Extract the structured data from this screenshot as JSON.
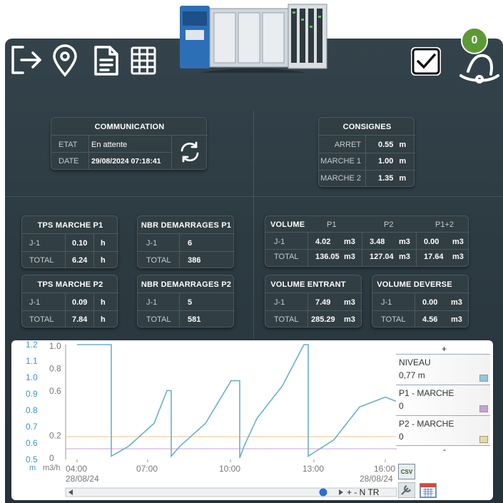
{
  "badge": {
    "count": "0"
  },
  "communication": {
    "title": "COMMUNICATION",
    "etat_label": "ETAT",
    "etat_value": "En attente",
    "date_label": "DATE",
    "date_value": "29/08/2024 07:18:41"
  },
  "consignes": {
    "title": "CONSIGNES",
    "rows": [
      {
        "label": "ARRET",
        "value": "0.55",
        "unit": "m"
      },
      {
        "label": "MARCHE 1",
        "value": "1.00",
        "unit": "m"
      },
      {
        "label": "MARCHE 2",
        "value": "1.35",
        "unit": "m"
      }
    ]
  },
  "tps_p1": {
    "title": "TPS MARCHE P1",
    "j1_label": "J-1",
    "j1_value": "0.10",
    "total_label": "TOTAL",
    "total_value": "6.24",
    "unit": "h"
  },
  "nbr_p1": {
    "title": "NBR DEMARRAGES P1",
    "j1_label": "J-1",
    "j1_value": "6",
    "total_label": "TOTAL",
    "total_value": "386"
  },
  "tps_p2": {
    "title": "TPS MARCHE P2",
    "j1_label": "J-1",
    "j1_value": "0.09",
    "total_label": "TOTAL",
    "total_value": "7.84",
    "unit": "h"
  },
  "nbr_p2": {
    "title": "NBR DEMARRAGES P2",
    "j1_label": "J-1",
    "j1_value": "5",
    "total_label": "TOTAL",
    "total_value": "581"
  },
  "volume": {
    "title": "VOLUME",
    "col_p1": "P1",
    "col_p2": "P2",
    "col_p12": "P1+2",
    "j1_label": "J-1",
    "total_label": "TOTAL",
    "unit": "m3",
    "j1": [
      "4.02",
      "3.48",
      "0.00"
    ],
    "total": [
      "136.05",
      "127.04",
      "17.64"
    ]
  },
  "volume_entrant": {
    "title": "VOLUME ENTRANT",
    "j1_label": "J-1",
    "j1_value": "7.49",
    "total_label": "TOTAL",
    "total_value": "285.29",
    "unit": "m3"
  },
  "volume_deverse": {
    "title": "VOLUME DEVERSE",
    "j1_label": "J-1",
    "j1_value": "0.00",
    "total_label": "TOTAL",
    "total_value": "4.56",
    "unit": "m3"
  },
  "chart": {
    "left_axis_unit": "m",
    "right_axis_unit": "m3/h",
    "left_ticks": [
      "1.2",
      "1.1",
      "1.0",
      "0.9",
      "0.8",
      "0.7",
      "0.6",
      "0.5"
    ],
    "right_ticks": [
      "1.0",
      "0.8",
      "0.6",
      "0.2",
      "0"
    ],
    "x_ticks": [
      "04:00",
      "07:00",
      "10:00",
      "13:00",
      "16:00"
    ],
    "x_date_left": "28/08/24",
    "x_date_right": "28/08/24",
    "legend": [
      {
        "name": "NIVEAU",
        "value": "0,77 m",
        "color": "#8fc9de"
      },
      {
        "name": "P1 - MARCHE",
        "value": "0",
        "color": "#c8a0d0"
      },
      {
        "name": "P2 - MARCHE",
        "value": "0",
        "color": "#e6dc9a"
      }
    ],
    "legend_plus": "+",
    "legend_minus": "-",
    "csv_label": "CSV",
    "nav_labels": "+ - N TR",
    "line_color": "#6aafcf"
  },
  "chart_data": {
    "type": "line",
    "xlabel": "",
    "ylabel": "m",
    "x": [
      "04:00",
      "05:00",
      "05:20",
      "06:00",
      "07:00",
      "07:30",
      "07:40",
      "08:00",
      "09:00",
      "10:00",
      "10:20",
      "10:30",
      "11:00",
      "12:00",
      "12:50",
      "13:00",
      "14:00",
      "15:00",
      "16:00",
      "16:30"
    ],
    "series": [
      {
        "name": "NIVEAU",
        "values": [
          1.2,
          1.2,
          0.52,
          0.58,
          0.72,
          0.92,
          0.52,
          0.58,
          0.72,
          0.98,
          0.51,
          0.58,
          0.75,
          0.95,
          1.2,
          0.52,
          0.62,
          0.82,
          0.88,
          0.85
        ]
      },
      {
        "name": "P1 - MARCHE",
        "values": [
          0,
          0,
          0,
          0,
          0,
          0,
          0,
          0,
          0,
          0,
          0,
          0,
          0,
          0,
          0,
          0,
          0,
          0,
          0,
          0
        ]
      },
      {
        "name": "P2 - MARCHE",
        "values": [
          0,
          0,
          0,
          0,
          0,
          0,
          0,
          0,
          0,
          0,
          0,
          0,
          0,
          0,
          0,
          0,
          0,
          0,
          0,
          0
        ]
      }
    ],
    "ylim": [
      0.5,
      1.2
    ]
  }
}
